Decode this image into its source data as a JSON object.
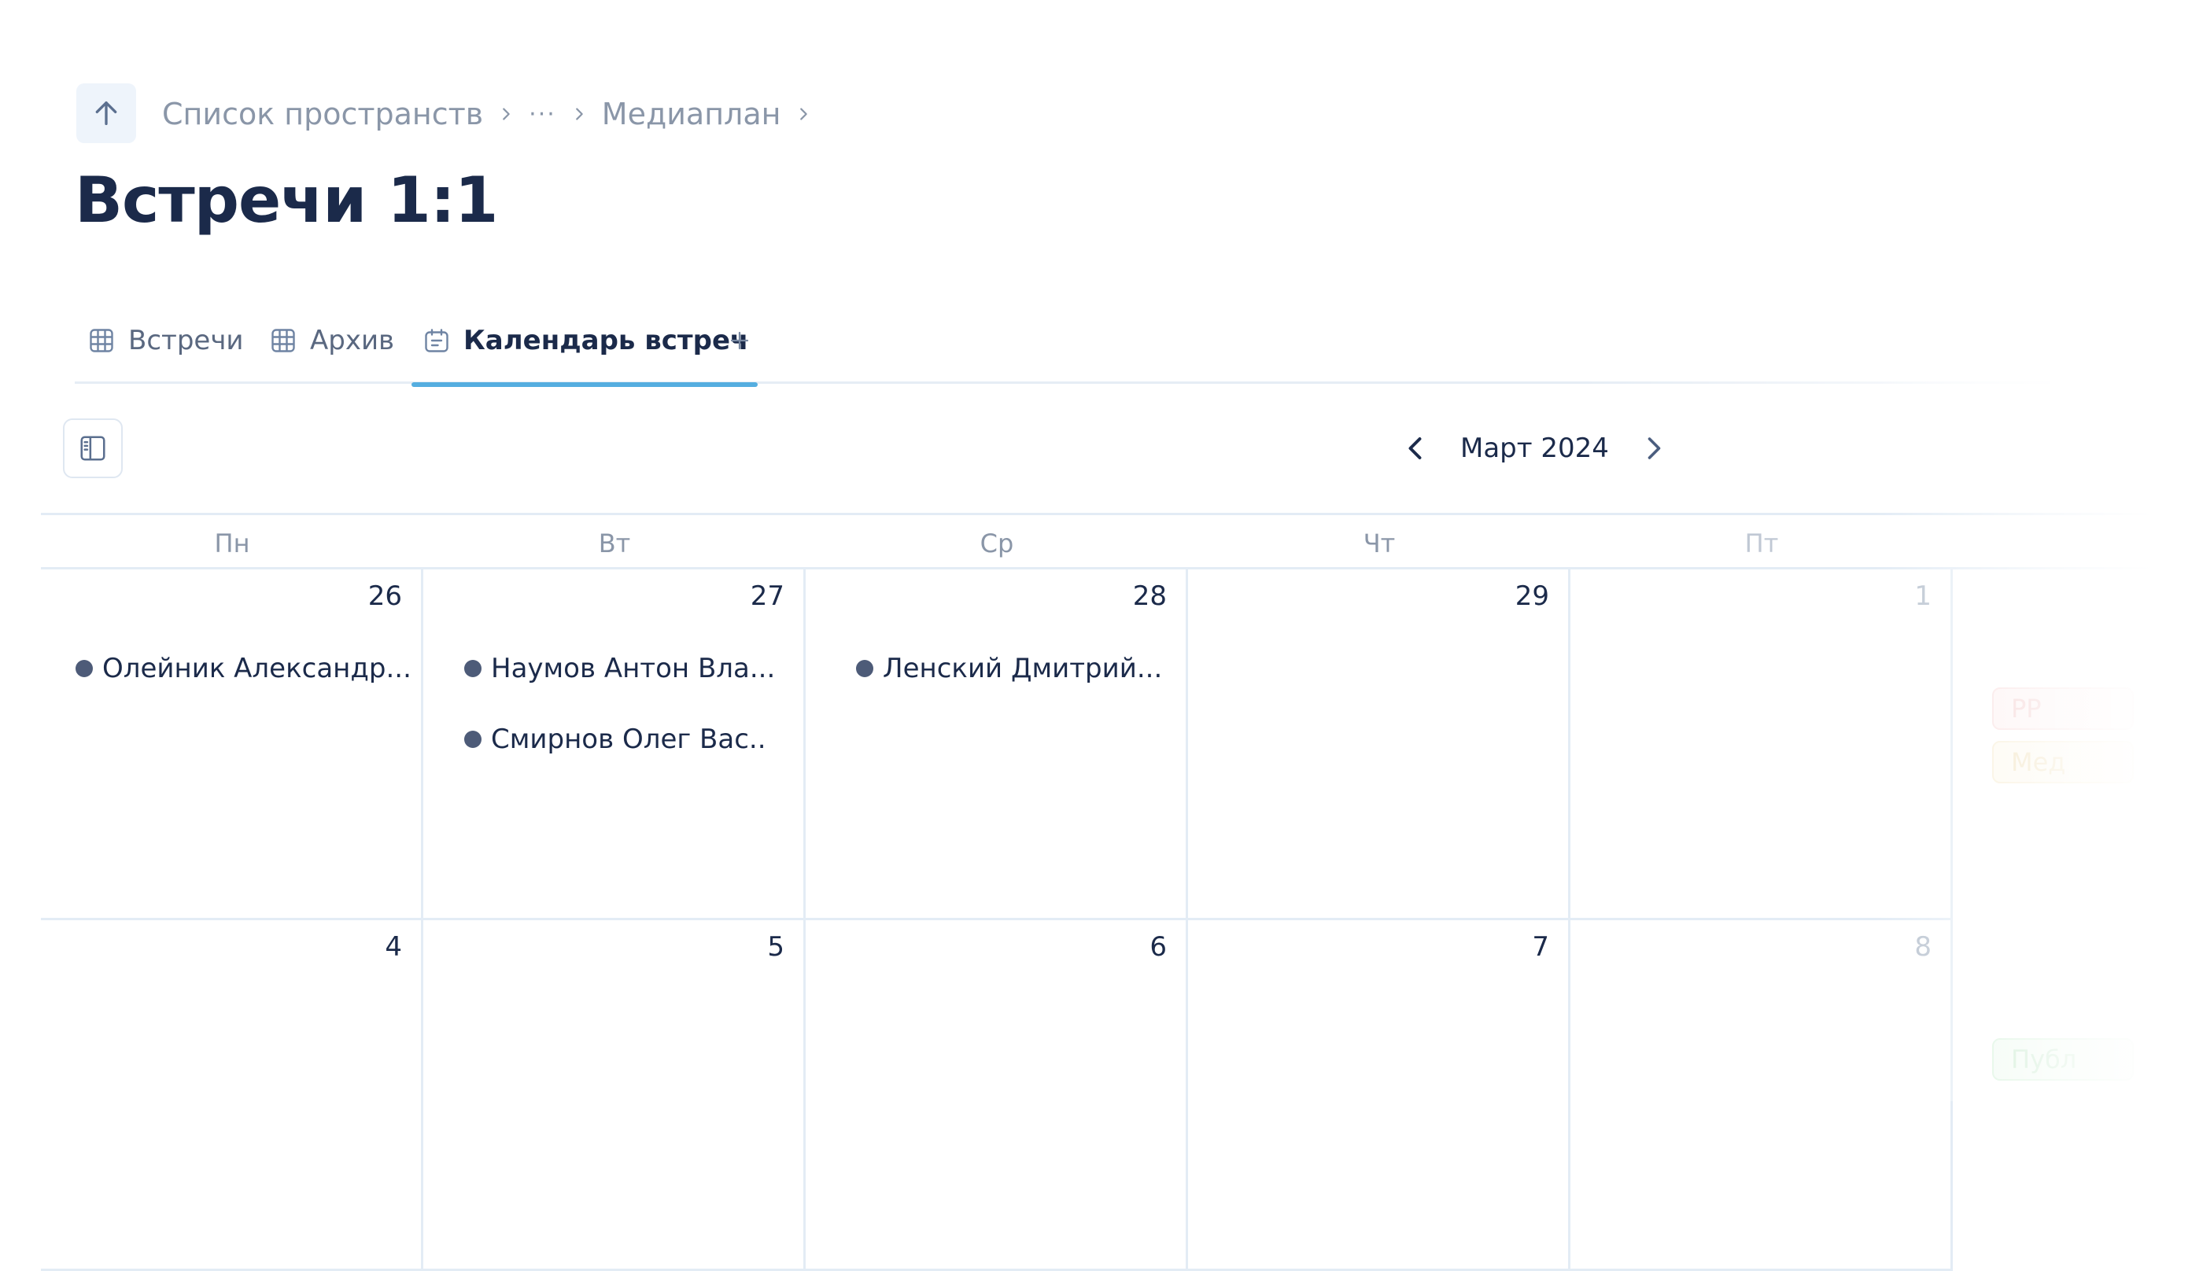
{
  "breadcrumb": {
    "items": [
      "Список пространств",
      "···",
      "Медиаплан"
    ]
  },
  "page": {
    "title": "Встречи 1:1"
  },
  "tabs": [
    {
      "label": "Встречи",
      "icon": "table-icon",
      "active": false
    },
    {
      "label": "Архив",
      "icon": "table-icon",
      "active": false
    },
    {
      "label": "Календарь встреч",
      "icon": "calendar-icon",
      "active": true
    }
  ],
  "toolbar": {
    "month_label": "Март 2024"
  },
  "calendar": {
    "weekdays": [
      "Пн",
      "Вт",
      "Ср",
      "Чт",
      "Пт"
    ],
    "weeks": [
      {
        "days": [
          {
            "num": "26",
            "events": [
              "Олейник Александр..."
            ]
          },
          {
            "num": "27",
            "events": [
              "Наумов Антон Вла...",
              "Смирнов Олег Вас.."
            ]
          },
          {
            "num": "28",
            "events": [
              "Ленский Дмитрий..."
            ]
          },
          {
            "num": "29",
            "events": []
          },
          {
            "num": "1",
            "events": []
          }
        ]
      },
      {
        "days": [
          {
            "num": "4",
            "events": []
          },
          {
            "num": "5",
            "events": []
          },
          {
            "num": "6",
            "events": []
          },
          {
            "num": "7",
            "events": []
          },
          {
            "num": "8",
            "events": []
          }
        ]
      }
    ],
    "side_tags": [
      "РР",
      "Мед",
      "Публ"
    ]
  },
  "colors": {
    "title": "#1b2a4a",
    "muted": "#8a96a8",
    "accent": "#55aee0",
    "event_dot": "#4d5b78",
    "grid": "#e3ecf5"
  }
}
